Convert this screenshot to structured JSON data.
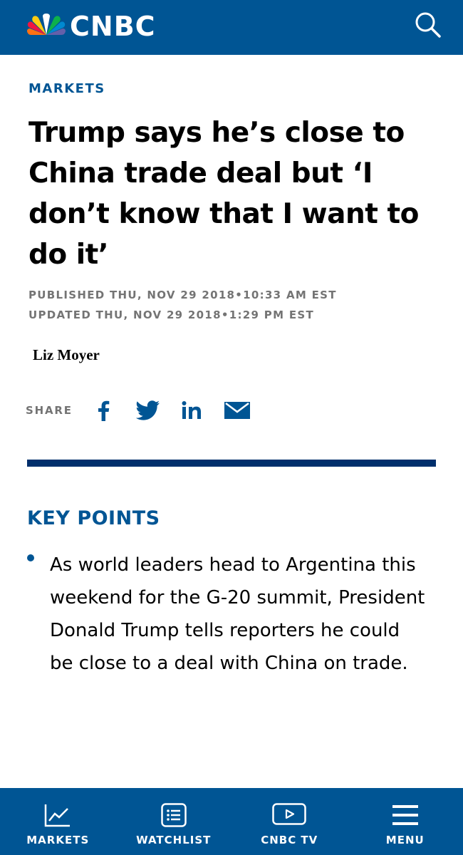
{
  "header": {
    "brand": "CNBC",
    "logo_icon": "peacock-logo-icon",
    "search_icon": "search-icon",
    "colors": {
      "bar": "#005594"
    }
  },
  "article": {
    "section": "MARKETS",
    "headline": "Trump says he’s close to China trade deal but ‘I don’t know that I want to do it’",
    "published": "PUBLISHED THU, NOV 29 2018•10:33 AM EST",
    "updated": "UPDATED THU, NOV 29 2018•1:29 PM EST",
    "author": "Liz Moyer"
  },
  "share": {
    "label": "SHARE",
    "icons": [
      "facebook-icon",
      "twitter-icon",
      "linkedin-icon",
      "email-icon"
    ]
  },
  "key_points": {
    "title": "KEY POINTS",
    "items": [
      "As world leaders head to Argentina this weekend for the G-20 summit, President Donald Trump tells reporters he could be close to a deal with China on trade."
    ]
  },
  "bottom_nav": {
    "items": [
      {
        "label": "MARKETS",
        "icon": "chart-icon"
      },
      {
        "label": "WATCHLIST",
        "icon": "list-icon"
      },
      {
        "label": "CNBC TV",
        "icon": "tv-play-icon"
      },
      {
        "label": "MENU",
        "icon": "hamburger-icon"
      }
    ]
  },
  "colors": {
    "brand_blue": "#005594",
    "divider": "#002f6c",
    "meta_gray": "#747474"
  }
}
